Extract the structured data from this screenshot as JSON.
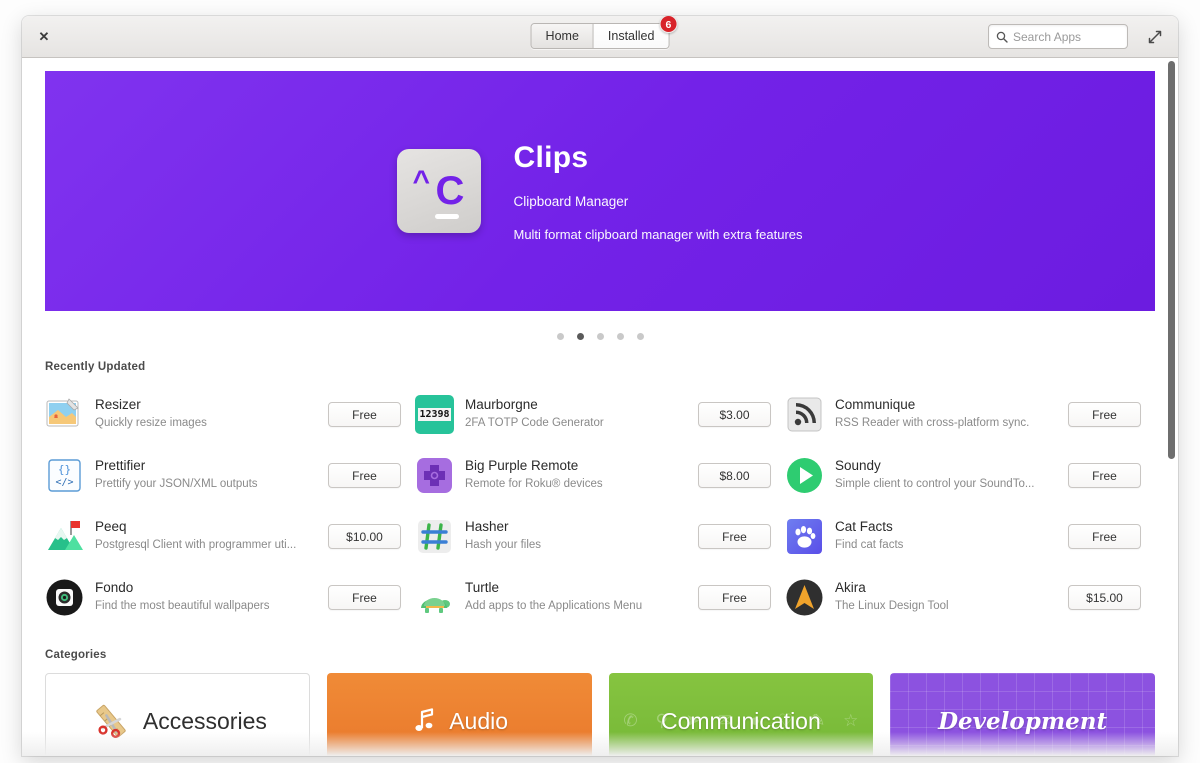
{
  "window": {
    "close_label": "✕",
    "maximize_icon": "expand-icon"
  },
  "header": {
    "tabs": [
      {
        "label": "Home",
        "active": false
      },
      {
        "label": "Installed",
        "active": true,
        "badge": "6"
      }
    ],
    "search": {
      "placeholder": "Search Apps",
      "value": "",
      "icon": "search-icon"
    }
  },
  "banner": {
    "title": "Clips",
    "subtitle": "Clipboard Manager",
    "description": "Multi format clipboard manager with extra features",
    "icon_caret": "^",
    "icon_char": "C",
    "background_color": "#7322e8",
    "dots": {
      "count": 5,
      "active_index": 1
    }
  },
  "recently_updated": {
    "title": "Recently Updated",
    "apps": [
      {
        "name": "Resizer",
        "desc": "Quickly resize images",
        "price": "Free",
        "icon": "image-resize-icon"
      },
      {
        "name": "Maurborgne",
        "desc": "2FA TOTP Code Generator",
        "price": "$3.00",
        "icon": "digits-icon"
      },
      {
        "name": "Communique",
        "desc": "RSS Reader with cross-platform sync.",
        "price": "Free",
        "icon": "rss-icon"
      },
      {
        "name": "Prettifier",
        "desc": "Prettify your JSON/XML outputs",
        "price": "Free",
        "icon": "code-braces-icon"
      },
      {
        "name": "Big Purple Remote",
        "desc": "Remote for Roku® devices",
        "price": "$8.00",
        "icon": "dpad-icon"
      },
      {
        "name": "Soundy",
        "desc": "Simple client to control your SoundTo...",
        "price": "Free",
        "icon": "play-circle-icon"
      },
      {
        "name": "Peeq",
        "desc": "Postgresql Client with programmer uti...",
        "price": "$10.00",
        "icon": "mountain-flag-icon"
      },
      {
        "name": "Hasher",
        "desc": "Hash your files",
        "price": "Free",
        "icon": "hash-icon"
      },
      {
        "name": "Cat Facts",
        "desc": "Find cat facts",
        "price": "Free",
        "icon": "paw-icon"
      },
      {
        "name": "Fondo",
        "desc": "Find the most beautiful wallpapers",
        "price": "Free",
        "icon": "camera-lens-icon"
      },
      {
        "name": "Turtle",
        "desc": "Add apps to the Applications Menu",
        "price": "Free",
        "icon": "turtle-icon"
      },
      {
        "name": "Akira",
        "desc": "The Linux Design Tool",
        "price": "$15.00",
        "icon": "arrow-compass-icon"
      }
    ]
  },
  "categories": {
    "title": "Categories",
    "items": [
      {
        "label": "Accessories",
        "style": "cat-accessories",
        "color": "#ffffff",
        "icon": "ruler-scissors-icon"
      },
      {
        "label": "Audio",
        "style": "cat-audio",
        "color": "#e8762a",
        "icon": "music-note-icon"
      },
      {
        "label": "Communication",
        "style": "cat-communication",
        "color": "#73b636",
        "icon": "chat-icons"
      },
      {
        "label": "Development",
        "style": "cat-development",
        "color": "#8c52e0",
        "icon": "grid-pattern"
      }
    ]
  }
}
